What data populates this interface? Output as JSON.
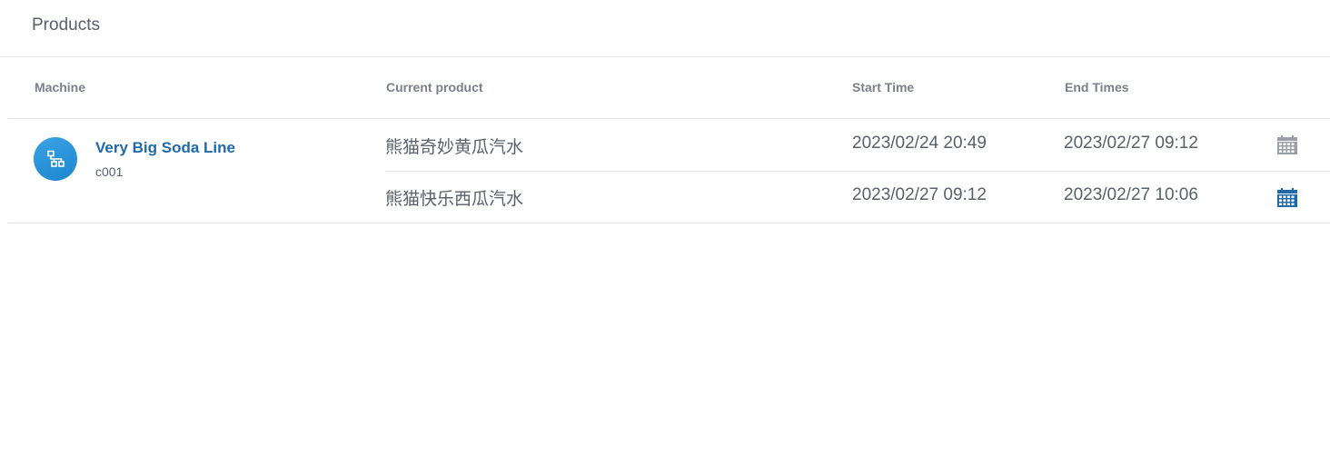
{
  "panel": {
    "title": "Products"
  },
  "table": {
    "columns": {
      "machine": "Machine",
      "current_product": "Current product",
      "start_time": "Start Time",
      "end_times": "End Times"
    },
    "machine": {
      "name": "Very Big Soda Line",
      "code": "c001",
      "icon": "network-hierarchy-icon"
    },
    "rows": [
      {
        "product": "熊猫奇妙黄瓜汽水",
        "start": "2023/02/24 20:49",
        "end": "2023/02/27 09:12",
        "icon": "calendar-icon",
        "icon_color": "#9a9ea5"
      },
      {
        "product": "熊猫快乐西瓜汽水",
        "start": "2023/02/27 09:12",
        "end": "2023/02/27 10:06",
        "icon": "calendar-icon",
        "icon_color": "#1f69a8"
      }
    ]
  },
  "colors": {
    "accent": "#1f69a8",
    "avatar": "#2a93d8",
    "divider": "#e4e6ea",
    "text": "#59606b"
  }
}
